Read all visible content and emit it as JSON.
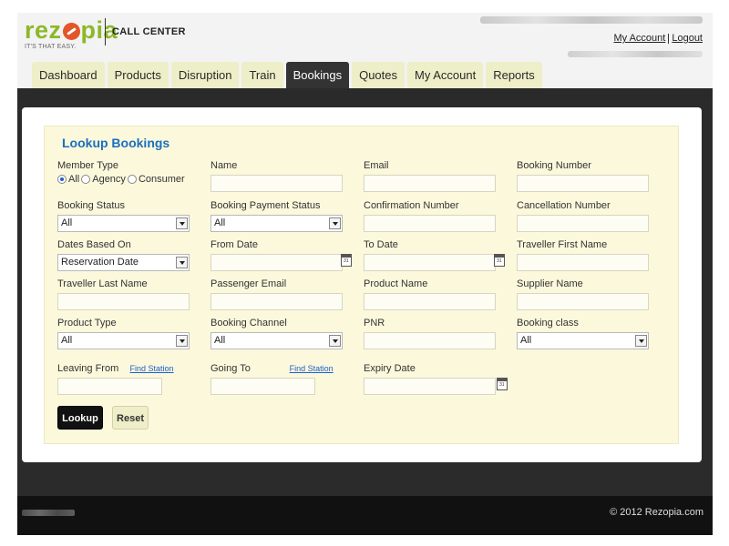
{
  "header": {
    "logo_text_left": "rez",
    "logo_text_right": "pia",
    "tagline": "IT'S THAT EASY.",
    "app_title": "CALL CENTER",
    "my_account_link": "My Account",
    "logout_link": "Logout"
  },
  "tabs": [
    {
      "label": "Dashboard",
      "active": false
    },
    {
      "label": "Products",
      "active": false
    },
    {
      "label": "Disruption",
      "active": false
    },
    {
      "label": "Train",
      "active": false
    },
    {
      "label": "Bookings",
      "active": true
    },
    {
      "label": "Quotes",
      "active": false
    },
    {
      "label": "My Account",
      "active": false
    },
    {
      "label": "Reports",
      "active": false
    }
  ],
  "form": {
    "title": "Lookup Bookings",
    "member_type": {
      "label": "Member Type",
      "options": [
        "All",
        "Agency",
        "Consumer"
      ],
      "selected": "All"
    },
    "name_label": "Name",
    "email_label": "Email",
    "booking_number_label": "Booking Number",
    "booking_status": {
      "label": "Booking Status",
      "value": "All"
    },
    "booking_payment_status": {
      "label": "Booking Payment Status",
      "value": "All"
    },
    "confirmation_number_label": "Confirmation Number",
    "cancellation_number_label": "Cancellation Number",
    "dates_based_on": {
      "label": "Dates Based On",
      "value": "Reservation Date"
    },
    "from_date_label": "From Date",
    "to_date_label": "To Date",
    "traveller_first_name_label": "Traveller First Name",
    "traveller_last_name_label": "Traveller Last Name",
    "passenger_email_label": "Passenger Email",
    "product_name_label": "Product Name",
    "supplier_name_label": "Supplier Name",
    "product_type": {
      "label": "Product Type",
      "value": "All"
    },
    "booking_channel": {
      "label": "Booking Channel",
      "value": "All"
    },
    "pnr_label": "PNR",
    "booking_class": {
      "label": "Booking class",
      "value": "All"
    },
    "leaving_from_label": "Leaving From",
    "going_to_label": "Going To",
    "find_station_label": "Find Station",
    "expiry_date_label": "Expiry Date",
    "lookup_button": "Lookup",
    "reset_button": "Reset"
  },
  "footer": {
    "copyright": "© 2012 Rezopia.com"
  },
  "colors": {
    "brand_green": "#8db82a",
    "brand_orange": "#e3562a",
    "tab_bg": "#eeeec8",
    "tab_active_bg": "#333333",
    "form_bg": "#fbf8dc",
    "title_blue": "#1a6fbf"
  }
}
